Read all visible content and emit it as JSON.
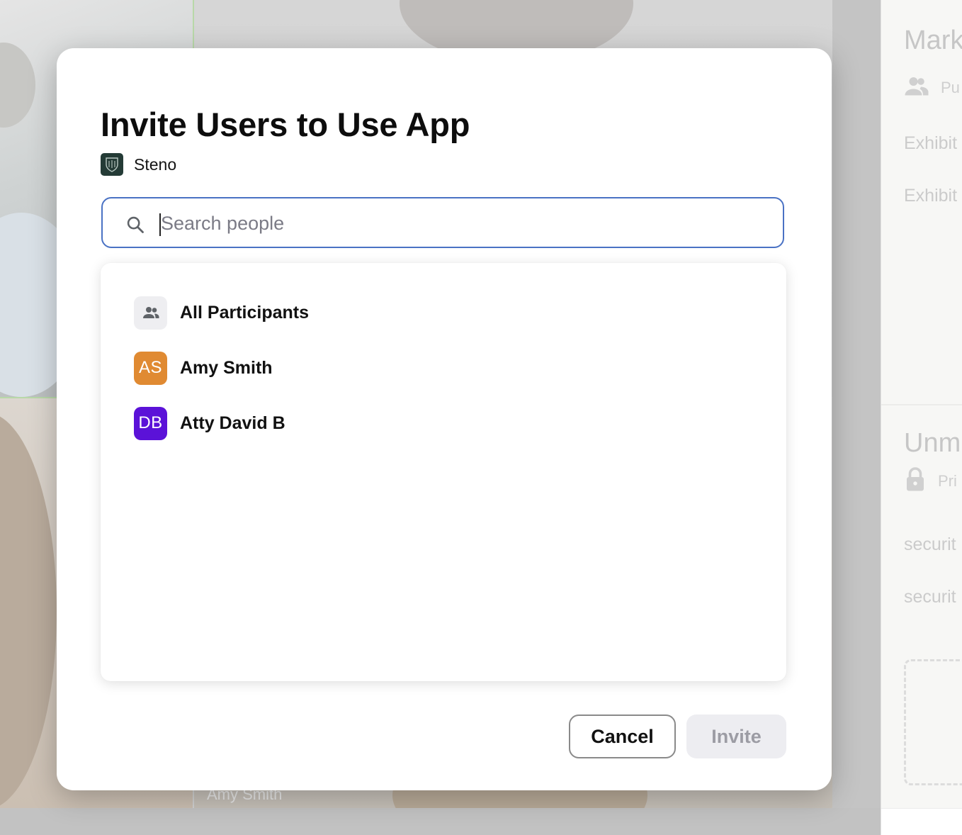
{
  "background": {
    "tile_name": "Amy Smith"
  },
  "side_panel": {
    "section1_title": "Mark",
    "section1_meta": "Pu",
    "section1_items": [
      "Exhibit",
      "Exhibit"
    ],
    "section2_title": "Unm",
    "section2_meta": "Pri",
    "section2_items": [
      "securit",
      "securit"
    ]
  },
  "modal": {
    "title": "Invite Users to Use App",
    "app_name": "Steno",
    "search": {
      "placeholder": "Search people",
      "value": ""
    },
    "options": [
      {
        "label": "All Participants",
        "icon": "group-icon"
      },
      {
        "label": "Amy Smith",
        "initials": "AS",
        "color": "#e08a32"
      },
      {
        "label": "Atty David B",
        "initials": "DB",
        "color": "#5b12d8"
      }
    ],
    "buttons": {
      "cancel": "Cancel",
      "invite": "Invite"
    }
  },
  "colors": {
    "focus_border": "#4a72c4",
    "invite_disabled_bg": "#ededf1",
    "app_logo": "#243b36"
  }
}
